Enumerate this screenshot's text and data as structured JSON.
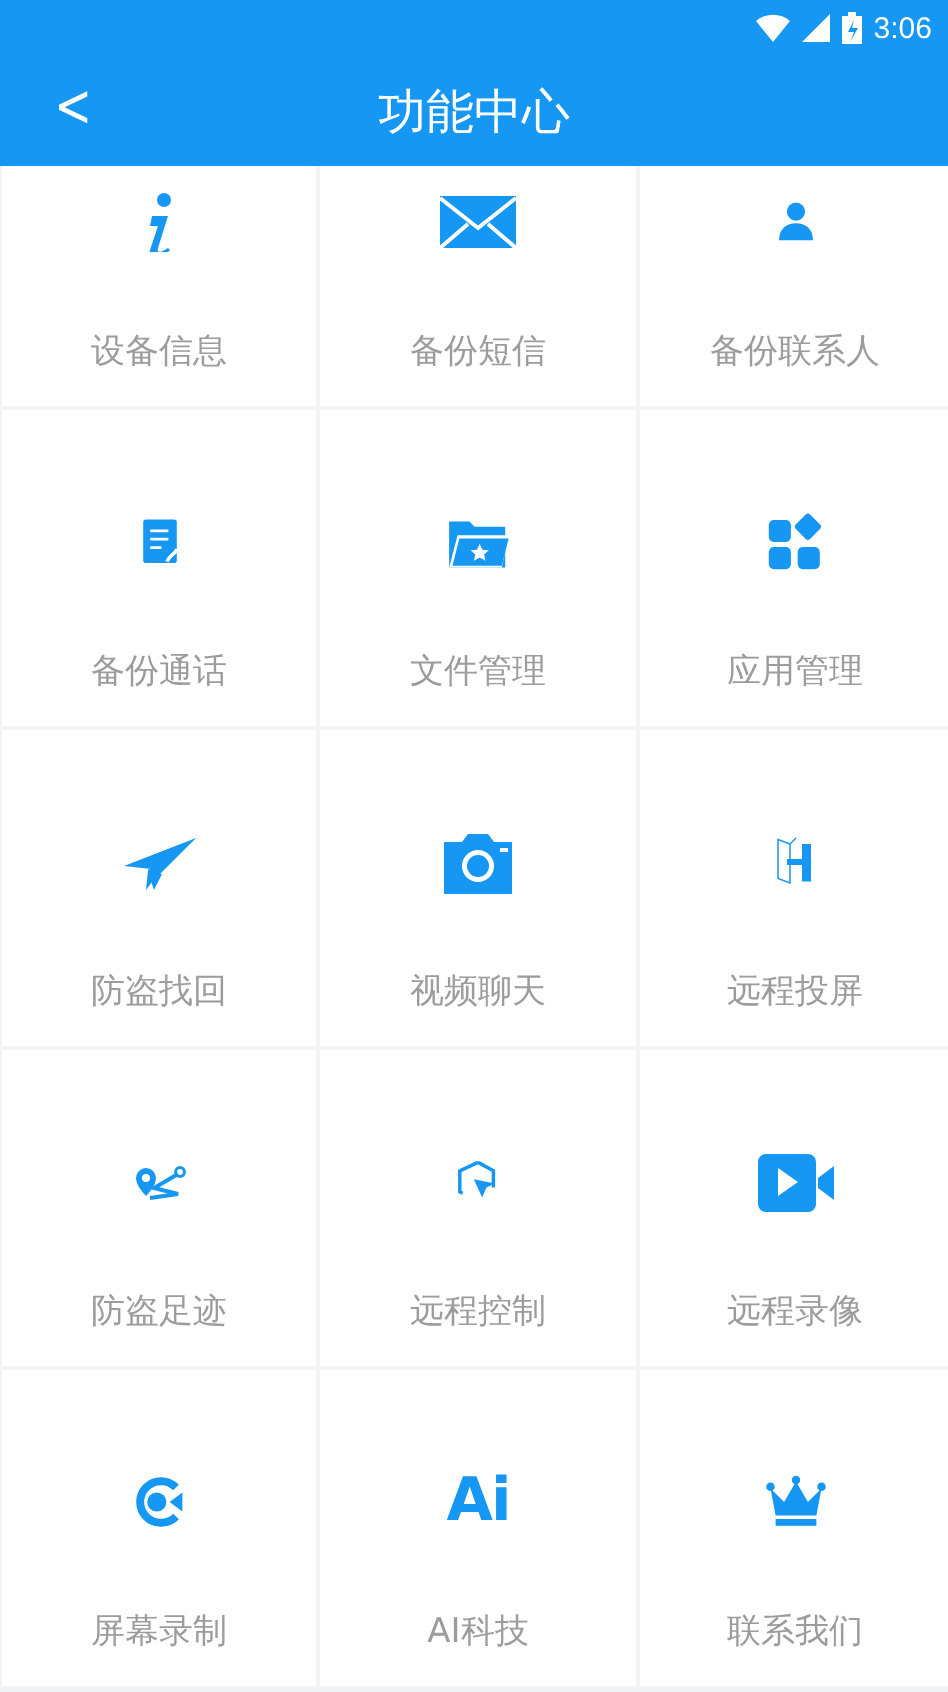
{
  "status_bar": {
    "time": "3:06"
  },
  "header": {
    "back": "<",
    "title": "功能中心"
  },
  "feature_rows": [
    {
      "tiles": [
        {
          "label": "设备信息"
        },
        {
          "label": "备份短信"
        },
        {
          "label": "备份联系人"
        }
      ]
    },
    {
      "tiles": [
        {
          "label": "备份通话"
        },
        {
          "label": "文件管理"
        },
        {
          "label": "应用管理"
        }
      ]
    },
    {
      "tiles": [
        {
          "label": "防盗找回"
        },
        {
          "label": "视频聊天"
        },
        {
          "label": "远程投屏"
        }
      ]
    },
    {
      "tiles": [
        {
          "label": "防盗足迹"
        },
        {
          "label": "远程控制"
        },
        {
          "label": "远程录像"
        }
      ]
    },
    {
      "tiles": [
        {
          "label": "屏幕录制"
        },
        {
          "glyph": "Ai",
          "label": "AI科技"
        },
        {
          "label": "联系我们"
        }
      ]
    }
  ]
}
